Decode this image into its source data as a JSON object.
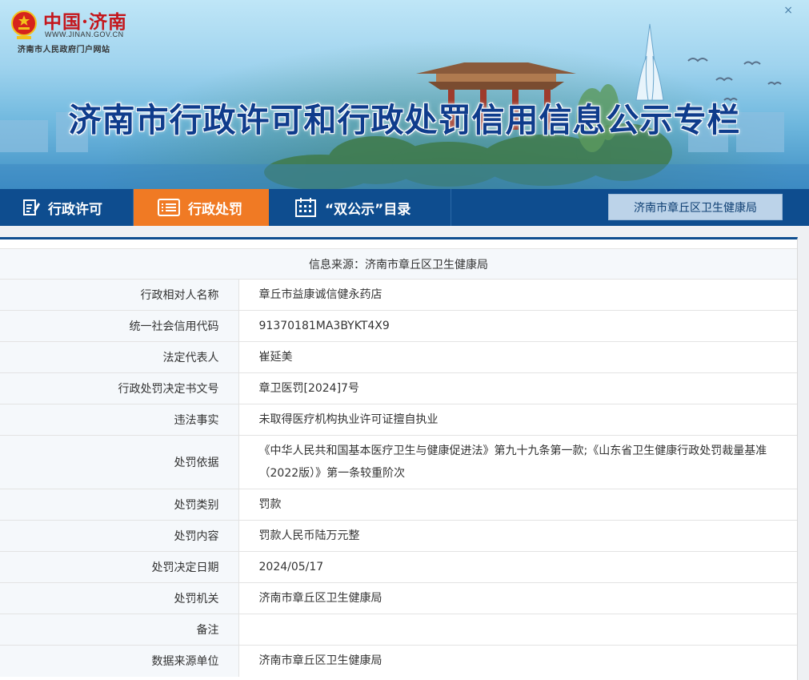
{
  "logo": {
    "brand": "中国·济南",
    "url": "WWW.JINAN.GOV.CN",
    "subtitle": "济南市人民政府门户网站"
  },
  "window": {
    "close_symbol": "×"
  },
  "banner": {
    "title": "济南市行政许可和行政处罚信用信息公示专栏"
  },
  "nav": {
    "items": [
      {
        "label": "行政许可",
        "icon": "edit-doc-icon",
        "active": false
      },
      {
        "label": "行政处罚",
        "icon": "list-icon",
        "active": true
      },
      {
        "label": "“双公示”目录",
        "icon": "calendar-icon",
        "active": false
      }
    ],
    "department": "济南市章丘区卫生健康局"
  },
  "colors": {
    "nav_bg": "#0e4d8f",
    "active_tab": "#f07a24",
    "title": "#0f3c8c",
    "label_bg": "#f5f8fb"
  },
  "record": {
    "source_line": "信息来源：济南市章丘区卫生健康局",
    "rows": [
      {
        "label": "行政相对人名称",
        "value": "章丘市益康诚信健永药店"
      },
      {
        "label": "统一社会信用代码",
        "value": "91370181MA3BYKT4X9"
      },
      {
        "label": "法定代表人",
        "value": "崔延美"
      },
      {
        "label": "行政处罚决定书文号",
        "value": "章卫医罚[2024]7号"
      },
      {
        "label": "违法事实",
        "value": "未取得医疗机构执业许可证擅自执业"
      },
      {
        "label": "处罚依据",
        "value": "《中华人民共和国基本医疗卫生与健康促进法》第九十九条第一款;《山东省卫生健康行政处罚裁量基准（2022版）》第一条较重阶次"
      },
      {
        "label": "处罚类别",
        "value": "罚款"
      },
      {
        "label": "处罚内容",
        "value": "罚款人民币陆万元整"
      },
      {
        "label": "处罚决定日期",
        "value": "2024/05/17"
      },
      {
        "label": "处罚机关",
        "value": "济南市章丘区卫生健康局"
      },
      {
        "label": "备注",
        "value": ""
      },
      {
        "label": "数据来源单位",
        "value": "济南市章丘区卫生健康局"
      }
    ]
  }
}
